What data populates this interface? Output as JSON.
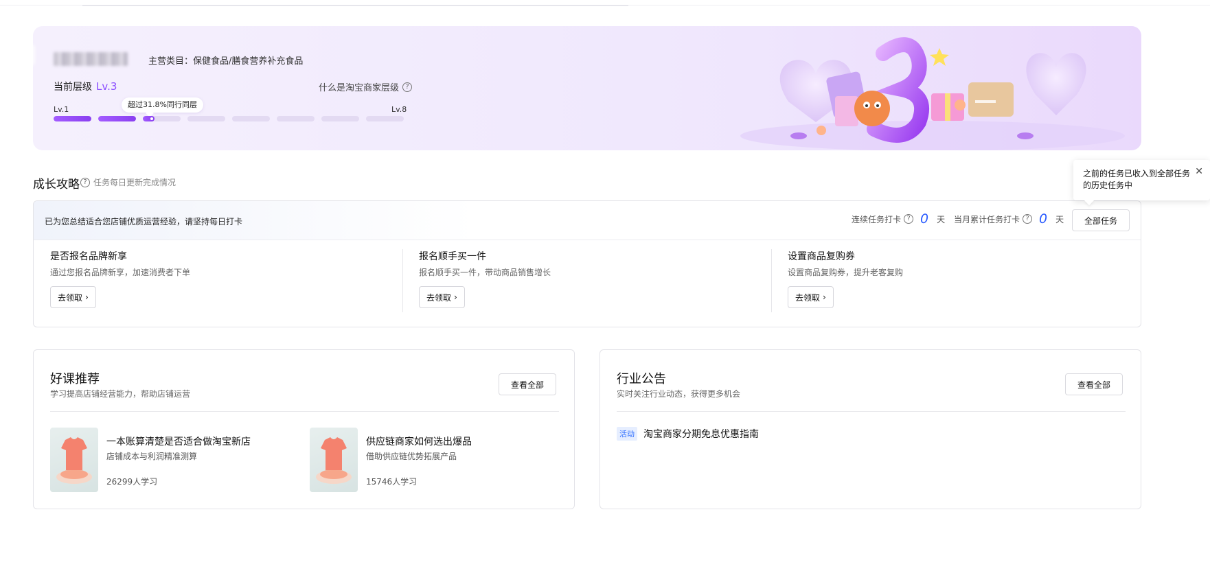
{
  "banner": {
    "main_category": "主营类目：保健食品/膳食营养补充食品",
    "level_label": "当前层级",
    "level_value": "Lv.3",
    "what_is_level": "什么是淘宝商家层级",
    "lv_min": "Lv.1",
    "lv_max": "Lv.8",
    "tooltip": "超过31.8%同行同层",
    "level_bars": [
      1,
      1,
      0.3,
      0,
      0,
      0,
      0,
      0
    ]
  },
  "growth": {
    "title": "成长攻略",
    "subtitle": "任务每日更新完成情况",
    "hint": "已为您总结适合您店铺优质运营经验，请坚持每日打卡",
    "streak_label": "连续任务打卡",
    "streak_value": "0",
    "monthly_label": "当月累计任务打卡",
    "monthly_value": "0",
    "day_unit": "天",
    "all_tasks_label": "全部任务",
    "tasks": [
      {
        "title": "是否报名品牌新享",
        "desc": "通过您报名品牌新享，加速消费者下单",
        "button": "去领取"
      },
      {
        "title": "报名顺手买一件",
        "desc": "报名顺手买一件，带动商品销售增长",
        "button": "去领取"
      },
      {
        "title": "设置商品复购券",
        "desc": "设置商品复购券，提升老客复购",
        "button": "去领取"
      }
    ]
  },
  "popover": {
    "text": "之前的任务已收入到全部任务的历史任务中",
    "close": "✕"
  },
  "courses": {
    "title": "好课推荐",
    "subtitle": "学习提高店铺经营能力，帮助店铺运营",
    "view_all": "查看全部",
    "items": [
      {
        "name": "一本账算清楚是否适合做淘宝新店",
        "desc": "店铺成本与利润精准测算",
        "learners": "26299人学习"
      },
      {
        "name": "供应链商家如何选出爆品",
        "desc": "借助供应链优势拓展产品",
        "learners": "15746人学习"
      }
    ]
  },
  "announcements": {
    "title": "行业公告",
    "subtitle": "实时关注行业动态，获得更多机会",
    "view_all": "查看全部",
    "items": [
      {
        "tag": "活动",
        "text": "淘宝商家分期免息优惠指南"
      }
    ]
  },
  "colors": {
    "accent_purple": "#8a4dff",
    "counter_blue": "#2b5cff",
    "tag_blue": "#2b6cff"
  },
  "icons": {
    "help": "question-circle-icon",
    "chevron": "chevron-right-icon",
    "close": "close-icon"
  }
}
